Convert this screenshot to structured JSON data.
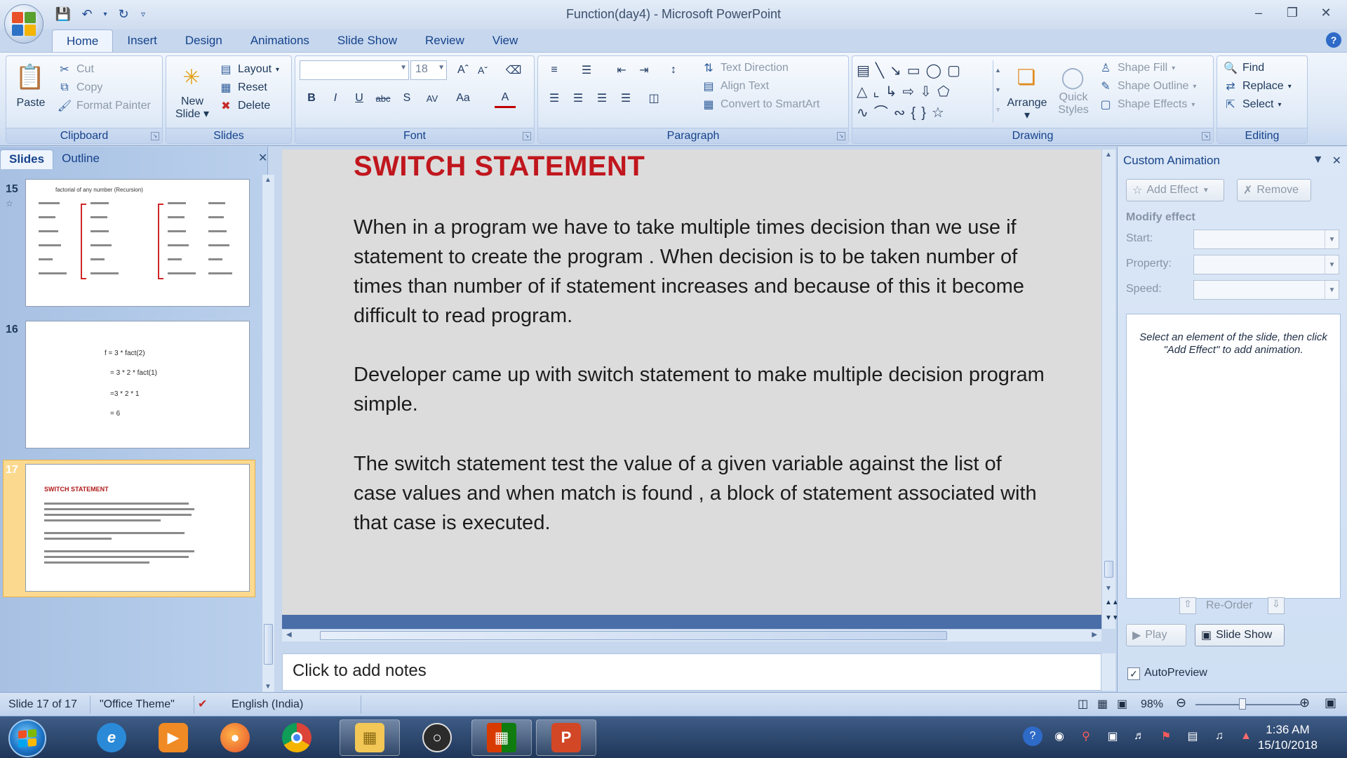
{
  "window": {
    "title": "Function(day4) - Microsoft PowerPoint"
  },
  "tabs": [
    "Home",
    "Insert",
    "Design",
    "Animations",
    "Slide Show",
    "Review",
    "View"
  ],
  "ribbon": {
    "clipboard": {
      "label": "Clipboard",
      "paste": "Paste",
      "cut": "Cut",
      "copy": "Copy",
      "format_painter": "Format Painter"
    },
    "slides": {
      "label": "Slides",
      "new_slide_1": "New",
      "new_slide_2": "Slide",
      "layout": "Layout",
      "reset": "Reset",
      "delete": "Delete"
    },
    "font": {
      "label": "Font",
      "size": "18"
    },
    "paragraph": {
      "label": "Paragraph",
      "text_direction": "Text Direction",
      "align_text": "Align Text",
      "convert_smartart": "Convert to SmartArt"
    },
    "drawing": {
      "label": "Drawing",
      "arrange": "Arrange",
      "quick_1": "Quick",
      "quick_2": "Styles",
      "shape_fill": "Shape Fill",
      "shape_outline": "Shape Outline",
      "shape_effects": "Shape Effects"
    },
    "editing": {
      "label": "Editing",
      "find": "Find",
      "replace": "Replace",
      "select": "Select"
    }
  },
  "slides_pane": {
    "tab_slides": "Slides",
    "tab_outline": "Outline",
    "thumbs": [
      {
        "num": "15",
        "title": "factorial of any number (Recursion)"
      },
      {
        "num": "16",
        "lines": [
          "f = 3 * fact(2)",
          "= 3 * 2 * fact(1)",
          "=3 * 2 * 1",
          "= 6"
        ]
      },
      {
        "num": "17",
        "title": "SWITCH STATEMENT"
      }
    ]
  },
  "slide": {
    "title": "SWITCH STATEMENT",
    "paragraphs": [
      "When in a program we have to take multiple times decision than we use if statement to create the program . When decision is to be taken number of times than number of if statement increases and because of this it become difficult  to read program.",
      "Developer came up with switch statement to make multiple decision program simple.",
      "The switch statement  test the value of a given variable against the list of case values and when match is found , a block of statement associated with that case is executed."
    ]
  },
  "notes": {
    "placeholder": "Click to add notes"
  },
  "animation_pane": {
    "title": "Custom Animation",
    "add_effect": "Add Effect",
    "remove": "Remove",
    "modify_effect": "Modify effect",
    "start": "Start:",
    "property": "Property:",
    "speed": "Speed:",
    "hint": "Select an element of the slide, then click \"Add Effect\" to add animation.",
    "reorder": "Re-Order",
    "play": "Play",
    "slide_show": "Slide Show",
    "autopreview": "AutoPreview"
  },
  "status": {
    "slide_pos": "Slide 17 of 17",
    "theme": "\"Office Theme\"",
    "language": "English (India)",
    "zoom": "98%"
  },
  "taskbar": {
    "time": "1:36 AM",
    "date": "15/10/2018"
  },
  "colors": {
    "title_red": "#c0161d",
    "ribbon_blue": "#15428b",
    "selection_orange": "#f7c870"
  }
}
